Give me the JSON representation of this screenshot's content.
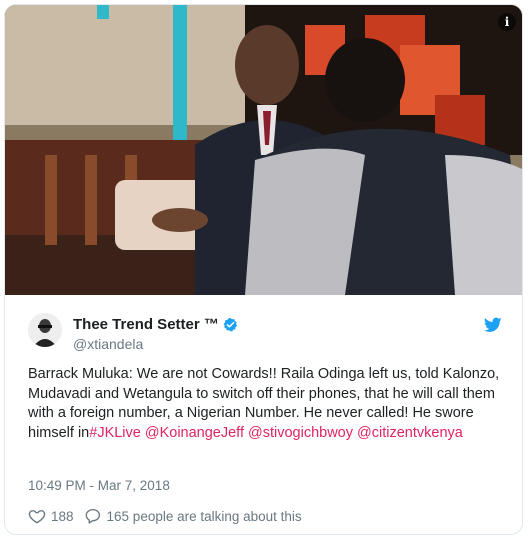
{
  "media": {
    "info_icon": "info-icon",
    "info_glyph": "i",
    "colors": {
      "backdrop": "#7a6a55",
      "red_set": "#d94a2a",
      "teal_pillar": "#2fb8c8"
    }
  },
  "author": {
    "display_name": "Thee Trend Setter ™",
    "handle": "@xtiandela",
    "verified_icon": "verified-badge-icon",
    "avatar_icon": "avatar"
  },
  "brand": {
    "logo_icon": "twitter-bird-icon",
    "color": "#1da1f2"
  },
  "tweet": {
    "text_before": "Barrack Muluka: We are not Cowards!! Raila Odinga left us, told Kalonzo, Mudavadi and Wetangula to switch off their phones, that he will call them with a foreign number, a Nigerian Number. He never called! He swore himself in",
    "hashtag": "#JKLive",
    "mention_1": "@KoinangeJeff",
    "mention_2": "@stivogichbwoy",
    "mention_3": "@citizentvkenya",
    "link_color": "#e0245e"
  },
  "timestamp": "10:49 PM - Mar 7, 2018",
  "actions": {
    "like_count": "188",
    "like_icon": "heart-icon",
    "reply_icon": "speech-bubble-icon",
    "talking_label": "165 people are talking about this"
  }
}
